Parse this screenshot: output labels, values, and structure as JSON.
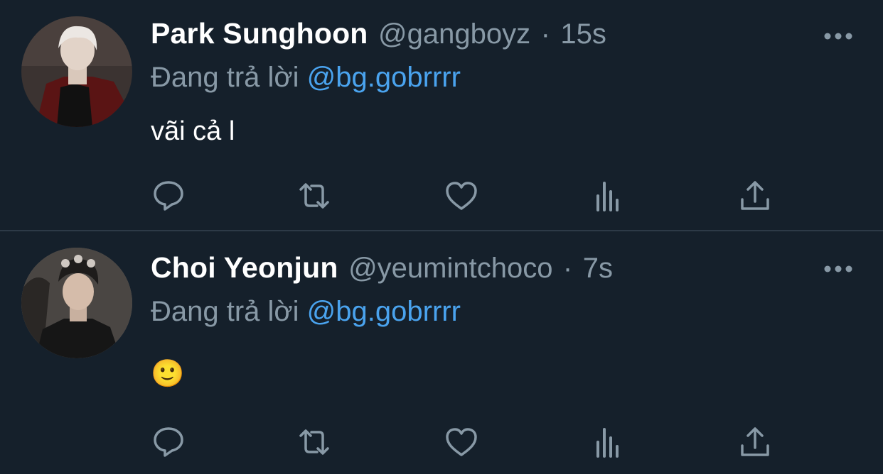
{
  "tweets": [
    {
      "name": "Park Sunghoon",
      "handle": "@gangboyz",
      "separator": "·",
      "time": "15s",
      "reply_prefix": "Đang trả lời",
      "reply_to": "@bg.gobrrrr",
      "text": "vãi cả l"
    },
    {
      "name": "Choi Yeonjun",
      "handle": "@yeumintchoco",
      "separator": "·",
      "time": "7s",
      "reply_prefix": "Đang trả lời",
      "reply_to": "@bg.gobrrrr",
      "text": "🙂"
    }
  ],
  "icons": [
    "more-icon",
    "reply-icon",
    "retweet-icon",
    "like-icon",
    "analytics-icon",
    "share-icon"
  ],
  "colors": {
    "background": "#15202b",
    "muted": "#8899a6",
    "accent": "#4aa3ee",
    "divider": "#2d3a47"
  }
}
